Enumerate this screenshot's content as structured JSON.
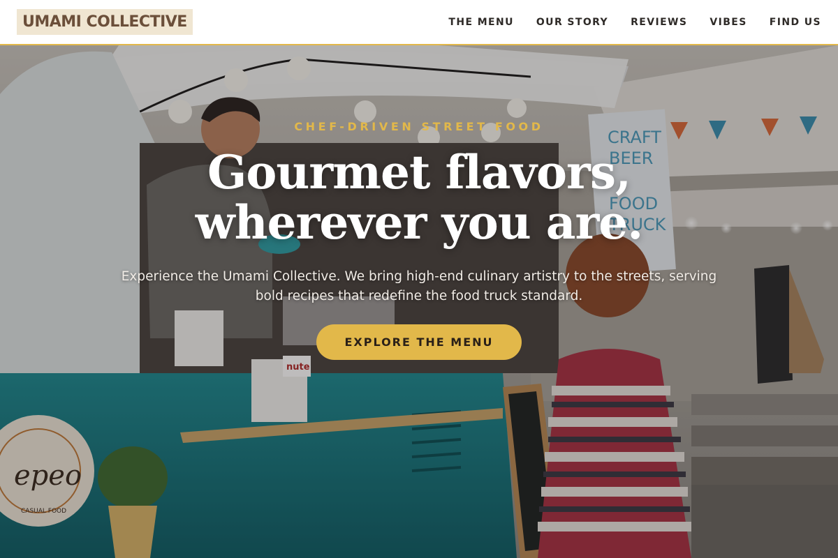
{
  "brand": {
    "logo_text": "UMAMI COLLECTIVE"
  },
  "nav": {
    "items": [
      {
        "label": "THE MENU"
      },
      {
        "label": "OUR STORY"
      },
      {
        "label": "REVIEWS"
      },
      {
        "label": "VIBES"
      },
      {
        "label": "FIND US"
      }
    ]
  },
  "hero": {
    "eyebrow": "CHEF-DRIVEN STREET FOOD",
    "headline_line1": "Gourmet flavors,",
    "headline_line2": "wherever you are.",
    "subtext": "Experience the Umami Collective. We bring high-end culinary artistry to the streets, serving bold recipes that redefine the food truck standard.",
    "cta_label": "EXPLORE THE MENU",
    "background": {
      "sign_text_1": "CRAFT",
      "sign_text_2": "BEER",
      "sign_text_3": "FOOD",
      "sign_text_4": "TRUCK",
      "badge_text": "epeo",
      "badge_subtext": "CASUAL FOOD",
      "jar_label": "nute"
    }
  },
  "colors": {
    "accent": "#e2b84a",
    "logo_bg": "#f0e6d2",
    "logo_text": "#6b4f3a",
    "nav_text": "#2e2a27",
    "truck_teal": "#1d7f86"
  }
}
